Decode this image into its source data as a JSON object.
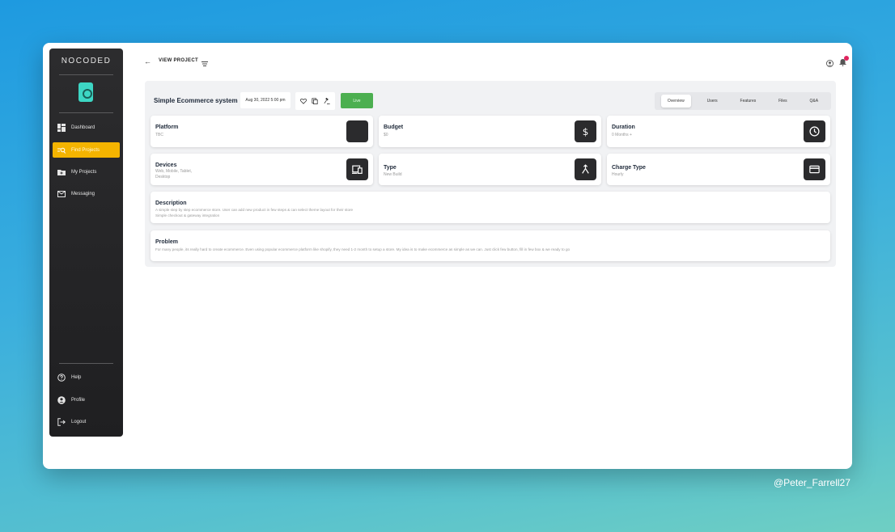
{
  "sidebar": {
    "logo": "NOCODED",
    "nav": [
      {
        "label": "Dashboard",
        "icon": "dashboard-icon"
      },
      {
        "label": "Find Projects",
        "icon": "find-projects-icon",
        "active": true
      },
      {
        "label": "My Projects",
        "icon": "folder-icon"
      },
      {
        "label": "Messaging",
        "icon": "mail-icon"
      }
    ],
    "bottom": [
      {
        "label": "Help",
        "icon": "help-icon"
      },
      {
        "label": "Profile",
        "icon": "profile-icon"
      },
      {
        "label": "Logout",
        "icon": "logout-icon"
      }
    ]
  },
  "topbar": {
    "title": "VIEW PROJECT"
  },
  "project": {
    "title": "Simple Ecommerce system",
    "date": "Aug 30, 2022 5:00 pm",
    "status": "Live",
    "tabs": [
      "Overview",
      "Users",
      "Features",
      "Files",
      "Q&A"
    ],
    "active_tab": "Overview"
  },
  "cards": {
    "platform": {
      "title": "Platform",
      "value": "TBC"
    },
    "budget": {
      "title": "Budget",
      "value": "$0"
    },
    "duration": {
      "title": "Duration",
      "value": "0 Months +"
    },
    "devices": {
      "title": "Devices",
      "value_line1": "Web, Mobile, Tablet,",
      "value_line2": "Desktop"
    },
    "type": {
      "title": "Type",
      "value": "New Build"
    },
    "charge": {
      "title": "Charge Type",
      "value": "Hourly"
    }
  },
  "description": {
    "title": "Description",
    "line1": "A simple step by step ecommerce store. User can add new product in few steps & can select theme layout for their store",
    "line2": "Simple checkout & gateway integration"
  },
  "problem": {
    "title": "Problem",
    "text": "For many people, its really hard to create ecommerce. Even using popular ecommerce platform like shopify, they need 1-2 month to setup a store. My idea is to make ecommerce as simple as we can. Just click few button, fill in few box & we ready to go"
  },
  "watermark": "@Peter_Farrell27",
  "colors": {
    "active_nav": "#f4b400",
    "live": "#4caf50",
    "badge": "#e0245e",
    "logo_mark": "#3dd6c4"
  }
}
